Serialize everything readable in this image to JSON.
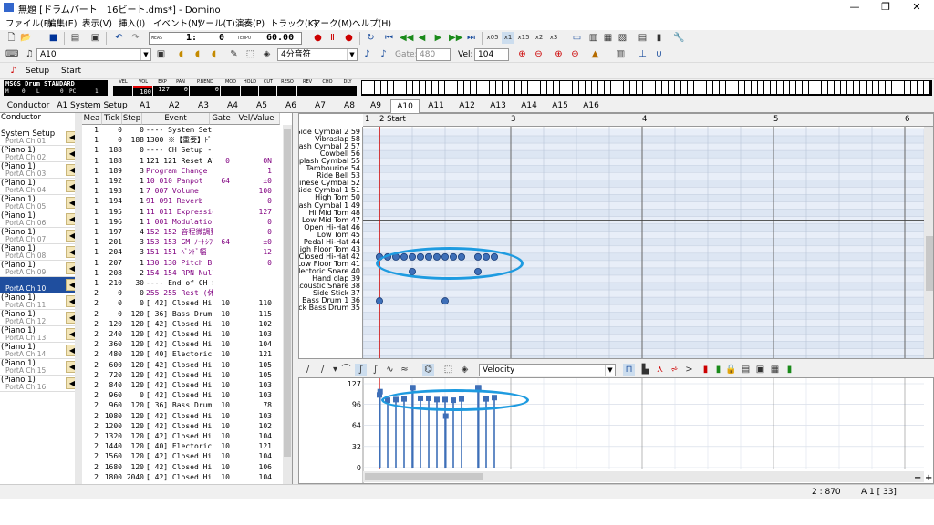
{
  "window": {
    "title": "無題 [ドラムパート　16ビート.dms*] - Domino",
    "min": "—",
    "max": "❐",
    "close": "✕"
  },
  "menu": [
    "ファイル(F)",
    "編集(E)",
    "表示(V)",
    "挿入(I)",
    "イベント(N)",
    "ツール(T)",
    "演奏(P)",
    "トラック(K)",
    "マーク(M)",
    "ヘルプ(H)"
  ],
  "transport": {
    "meas_label": "MEAS",
    "meas": "1:",
    "beat": "0",
    "tempo_label": "TEMPO",
    "tempo": "60.00",
    "speeds": [
      "x05",
      "x1",
      "x15",
      "x2",
      "x3"
    ]
  },
  "toolbar2": {
    "instrument_combo": "A10",
    "note_length": "4分音符",
    "gate_label": "Gate:",
    "gate": "480",
    "vel_label": "Vel:",
    "vel": "104"
  },
  "toolbar3": {
    "setup": "Setup",
    "start": "Start"
  },
  "monitor": {
    "device": "MSGS Drum STANDARD",
    "m_label": "M",
    "m": "0",
    "l_label": "L",
    "l": "0",
    "pc_label": "PC",
    "pc": "1",
    "headers": [
      "VEL",
      "VOL",
      "EXP",
      "PAN",
      "P.BEND",
      "MOD",
      "HOLD",
      "CUT",
      "RESO",
      "REV",
      "CHO",
      "DLY"
    ],
    "values": [
      "",
      "100",
      "127",
      "0",
      "0",
      "",
      "",
      "",
      "",
      "",
      "",
      ""
    ]
  },
  "track_tabs": [
    "Conductor",
    "A1 System Setup",
    "A1",
    "A2",
    "A3",
    "A4",
    "A5",
    "A6",
    "A7",
    "A8",
    "A9",
    "A10",
    "A11",
    "A12",
    "A13",
    "A14",
    "A15",
    "A16"
  ],
  "channels": [
    {
      "name": "Conductor",
      "port": ""
    },
    {
      "name": "System Setup",
      "port": "PortA  Ch.01"
    },
    {
      "name": "(Piano 1)",
      "port": "PortA  Ch.02"
    },
    {
      "name": "(Piano 1)",
      "port": "PortA  Ch.03"
    },
    {
      "name": "(Piano 1)",
      "port": "PortA  Ch.04"
    },
    {
      "name": "(Piano 1)",
      "port": "PortA  Ch.05"
    },
    {
      "name": "(Piano 1)",
      "port": "PortA  Ch.06"
    },
    {
      "name": "(Piano 1)",
      "port": "PortA  Ch.07"
    },
    {
      "name": "(Piano 1)",
      "port": "PortA  Ch.08"
    },
    {
      "name": "(Piano 1)",
      "port": "PortA  Ch.09"
    },
    {
      "name": "",
      "port": "PortA  Ch.10"
    },
    {
      "name": "(Piano 1)",
      "port": "PortA  Ch.11"
    },
    {
      "name": "(Piano 1)",
      "port": "PortA  Ch.12"
    },
    {
      "name": "(Piano 1)",
      "port": "PortA  Ch.13"
    },
    {
      "name": "(Piano 1)",
      "port": "PortA  Ch.14"
    },
    {
      "name": "(Piano 1)",
      "port": "PortA  Ch.15"
    },
    {
      "name": "(Piano 1)",
      "port": "PortA  Ch.16"
    }
  ],
  "event_headers": [
    "Mea",
    "Tick",
    "Step",
    "Event",
    "Gate",
    "Vel/Value"
  ],
  "events": [
    [
      "1",
      "0",
      "0",
      "---- System Setup -----------",
      "",
      ""
    ],
    [
      "1",
      "0",
      "188",
      "1300 ※【重要】ﾄﾞﾗﾑ(　【説明】",
      "",
      ""
    ],
    [
      "1",
      "188",
      "0",
      "---- CH Setup -------------",
      "",
      ""
    ],
    [
      "1",
      "188",
      "1",
      "121 121 Reset All Cor",
      "0",
      "ON"
    ],
    [
      "1",
      "189",
      "3",
      "Program Change",
      "",
      "1"
    ],
    [
      "1",
      "192",
      "1",
      "10 010 Panpot",
      "64",
      "±0"
    ],
    [
      "1",
      "193",
      "1",
      "7 007 Volume",
      "",
      "100"
    ],
    [
      "1",
      "194",
      "1",
      "91 091 Reverb",
      "",
      "0"
    ],
    [
      "1",
      "195",
      "1",
      "11 011 Expression",
      "",
      "127"
    ],
    [
      "1",
      "196",
      "1",
      "1 001 Modulation",
      "",
      "0"
    ],
    [
      "1",
      "197",
      "4",
      "152 152 音程微調整",
      "",
      "0"
    ],
    [
      "1",
      "201",
      "3",
      "153 153 GM ﾉｰﾄｼﾌﾄ",
      "64",
      "±0"
    ],
    [
      "1",
      "204",
      "3",
      "151 151 ﾍﾞﾝﾄﾞ幅",
      "",
      "12"
    ],
    [
      "1",
      "207",
      "1",
      "130 130 Pitch Br",
      "",
      "0"
    ],
    [
      "1",
      "208",
      "2",
      "154 154 RPN Null",
      "",
      ""
    ],
    [
      "1",
      "210",
      "30",
      "---- End of CH Setup ---------",
      "",
      ""
    ],
    [
      "2",
      "0",
      "0",
      "255 255 Rest (休符)",
      "",
      ""
    ],
    [
      "2",
      "0",
      "0",
      "[ 42] Closed Hi-",
      "10",
      "110"
    ],
    [
      "2",
      "0",
      "120",
      "[ 36] Bass Drum",
      "10",
      "115"
    ],
    [
      "2",
      "120",
      "120",
      "[ 42] Closed Hi-",
      "10",
      "102"
    ],
    [
      "2",
      "240",
      "120",
      "[ 42] Closed Hi-",
      "10",
      "103"
    ],
    [
      "2",
      "360",
      "120",
      "[ 42] Closed Hi-",
      "10",
      "104"
    ],
    [
      "2",
      "480",
      "120",
      "[ 40] Electoric",
      "10",
      "121"
    ],
    [
      "2",
      "600",
      "120",
      "[ 42] Closed Hi-",
      "10",
      "105"
    ],
    [
      "2",
      "720",
      "120",
      "[ 42] Closed Hi-",
      "10",
      "105"
    ],
    [
      "2",
      "840",
      "120",
      "[ 42] Closed Hi-",
      "10",
      "103"
    ],
    [
      "2",
      "960",
      "0",
      "[ 42] Closed Hi-",
      "10",
      "103"
    ],
    [
      "2",
      "960",
      "120",
      "[ 36] Bass Drum",
      "10",
      "78"
    ],
    [
      "2",
      "1080",
      "120",
      "[ 42] Closed Hi-",
      "10",
      "103"
    ],
    [
      "2",
      "1200",
      "120",
      "[ 42] Closed Hi-",
      "10",
      "102"
    ],
    [
      "2",
      "1320",
      "120",
      "[ 42] Closed Hi-",
      "10",
      "104"
    ],
    [
      "2",
      "1440",
      "120",
      "[ 40] Electoric",
      "10",
      "121"
    ],
    [
      "2",
      "1560",
      "120",
      "[ 42] Closed Hi-",
      "10",
      "104"
    ],
    [
      "2",
      "1680",
      "120",
      "[ 42] Closed Hi-",
      "10",
      "106"
    ],
    [
      "2",
      "1800",
      "2040",
      "[ 42] Closed Hi-",
      "10",
      "104"
    ]
  ],
  "note_names": [
    "Side Cymbal 2 59",
    "Vibraslap 58",
    "Crash Cymbal 2 57",
    "Cowbell 56",
    "Splash Cymbal 55",
    "Tambourine 54",
    "Ride Bell 53",
    "Chinese Cymbal 52",
    "Ride Cymbal 1 51",
    "High Tom 50",
    "Crash Cymbal 1 49",
    "Hi Mid Tom 48",
    "Low Mid Tom 47",
    "Open Hi-Hat 46",
    "Low Tom 45",
    "Pedal Hi-Hat 44",
    "High Floor Tom 43",
    "Closed Hi-Hat 42",
    "Low Floor Tom 41",
    "Electoric Snare 40",
    "Hand clap 39",
    "Acoustic Snare 38",
    "Side Stick 37",
    "Bass Drum 1 36",
    "Kick Bass Drum 35"
  ],
  "ruler": [
    "1",
    "2 Start",
    "3",
    "4",
    "5",
    "6"
  ],
  "notes_hihat_beats": [
    0,
    0.25,
    0.5,
    0.75,
    1,
    1.25,
    1.5,
    1.75,
    2,
    2.25,
    2.5,
    3,
    3.25,
    3.5
  ],
  "notes_snare_beats": [
    1,
    3
  ],
  "notes_kick_beats": [
    0,
    2
  ],
  "velocity_panel": {
    "combo": "Velocity",
    "scale": [
      "127",
      "96",
      "64",
      "32",
      "0"
    ]
  },
  "velocities": [
    110,
    102,
    103,
    104,
    121,
    105,
    105,
    103,
    103,
    102,
    104,
    121,
    104,
    106,
    104,
    103,
    78,
    115
  ],
  "status": {
    "pos": "2 : 870",
    "track": "A 1 [ 33]"
  }
}
